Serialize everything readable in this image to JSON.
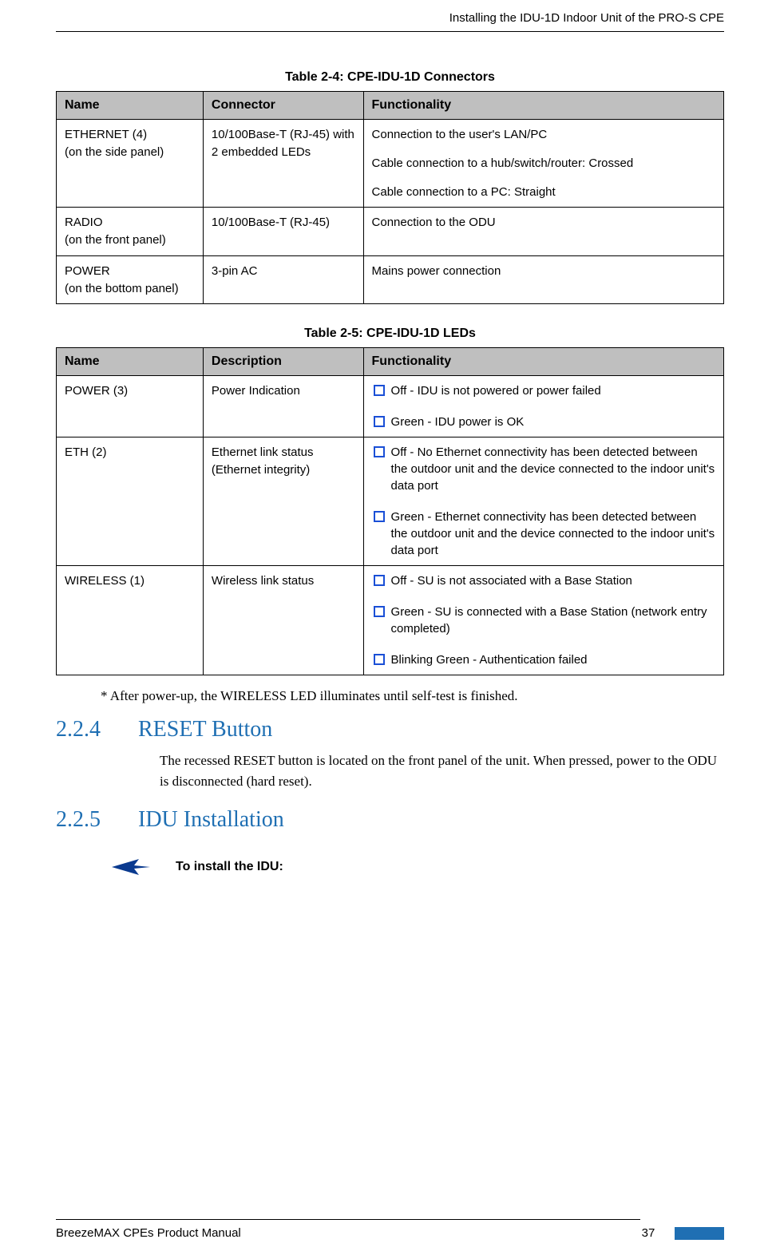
{
  "header": {
    "title": "Installing the IDU-1D Indoor Unit of the PRO-S CPE"
  },
  "table1": {
    "caption": "Table 2-4: CPE-IDU-1D Connectors",
    "headers": [
      "Name",
      "Connector",
      "Functionality"
    ],
    "rows": [
      {
        "name": "ETHERNET (4)\n(on the side panel)",
        "connector": "10/100Base-T (RJ-45) with 2 embedded LEDs",
        "functionality": [
          "Connection to the user's LAN/PC",
          "Cable connection to a hub/switch/router: Crossed",
          "Cable connection to a PC: Straight"
        ]
      },
      {
        "name": "RADIO\n(on the front panel)",
        "connector": "10/100Base-T (RJ-45)",
        "functionality": [
          "Connection to the ODU"
        ]
      },
      {
        "name": "POWER\n(on the bottom panel)",
        "connector": "3-pin AC",
        "functionality": [
          "Mains power connection"
        ]
      }
    ]
  },
  "table2": {
    "caption": "Table 2-5: CPE-IDU-1D LEDs",
    "headers": [
      "Name",
      "Description",
      "Functionality"
    ],
    "rows": [
      {
        "name": "POWER (3)",
        "description": "Power Indication",
        "bullets": [
          "Off - IDU is not powered or power failed",
          "Green - IDU power is OK"
        ]
      },
      {
        "name": "ETH (2)",
        "description": "Ethernet link status (Ethernet integrity)",
        "bullets": [
          "Off - No Ethernet connectivity has been detected between the outdoor unit and the device connected to the indoor unit's data port",
          "Green - Ethernet connectivity has been detected between the outdoor unit and the device connected to the indoor unit's data port"
        ]
      },
      {
        "name": "WIRELESS (1)",
        "description": "Wireless link status",
        "bullets": [
          "Off - SU is not associated with a Base Station",
          "Green - SU is connected with a Base Station (network entry completed)",
          "Blinking Green - Authentication failed"
        ]
      }
    ]
  },
  "footnote": "* After power-up, the WIRELESS LED illuminates until self-test is finished.",
  "section1": {
    "num": "2.2.4",
    "title": "RESET Button",
    "body": "The recessed RESET button is located on the front panel of the unit. When pressed, power to the ODU is disconnected (hard reset)."
  },
  "section2": {
    "num": "2.2.5",
    "title": "IDU Installation",
    "instruction": "To install the IDU:"
  },
  "footer": {
    "manual": "BreezeMAX CPEs Product Manual",
    "page": "37"
  }
}
